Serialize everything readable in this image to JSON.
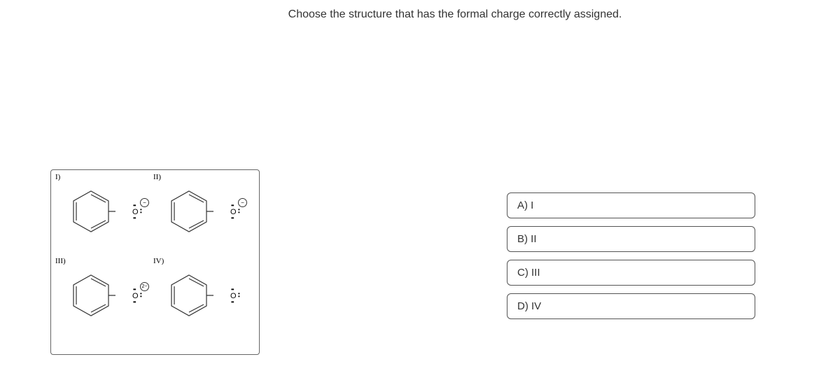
{
  "question": "Choose the structure that has the formal charge correctly assigned.",
  "structures": {
    "labels": [
      "I)",
      "II)",
      "III)",
      "IV)"
    ],
    "atom": "O",
    "charges": [
      "−",
      "−",
      "2−",
      ""
    ]
  },
  "answers": [
    {
      "label": "A) I"
    },
    {
      "label": "B) II"
    },
    {
      "label": "C) III"
    },
    {
      "label": "D) IV"
    }
  ]
}
